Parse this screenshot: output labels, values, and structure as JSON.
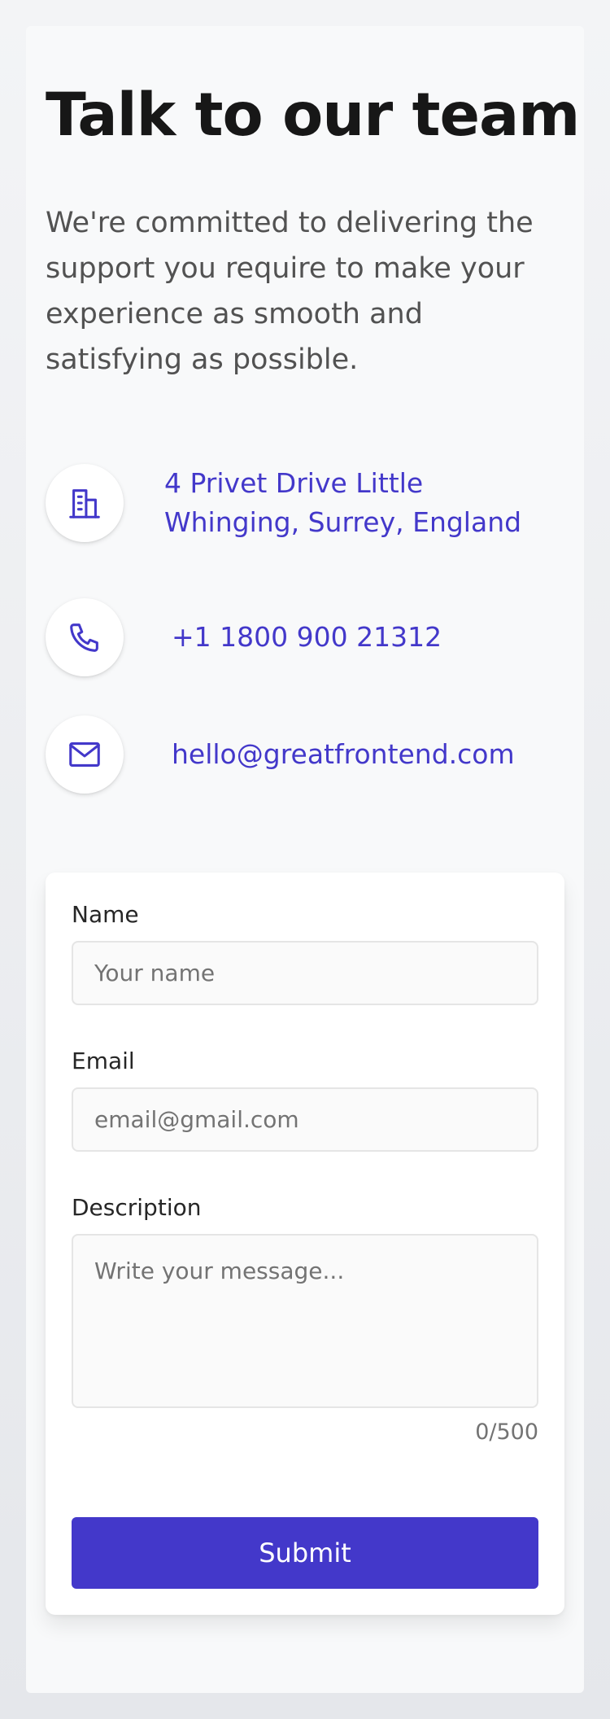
{
  "hero": {
    "title": "Talk to our team",
    "subtitle": "We're committed to delivering the support you require to make your experience as smooth and satisfying as possible."
  },
  "contact": {
    "address": "4 Privet Drive Little Whinging, Surrey, England",
    "phone": "+1 1800 900 21312",
    "email": "hello@greatfrontend.com",
    "address_icon": "building-icon",
    "phone_icon": "phone-icon",
    "email_icon": "mail-icon"
  },
  "form": {
    "name_label": "Name",
    "name_placeholder": "Your name",
    "name_value": "",
    "email_label": "Email",
    "email_placeholder": "email@gmail.com",
    "email_value": "",
    "description_label": "Description",
    "description_placeholder": "Write your message...",
    "description_value": "",
    "char_count": "0/500",
    "submit_label": "Submit"
  },
  "colors": {
    "accent": "#4338ca",
    "text_primary": "#171717",
    "text_secondary": "#525252",
    "input_background": "#fafafa",
    "input_border": "#e5e5e5"
  }
}
